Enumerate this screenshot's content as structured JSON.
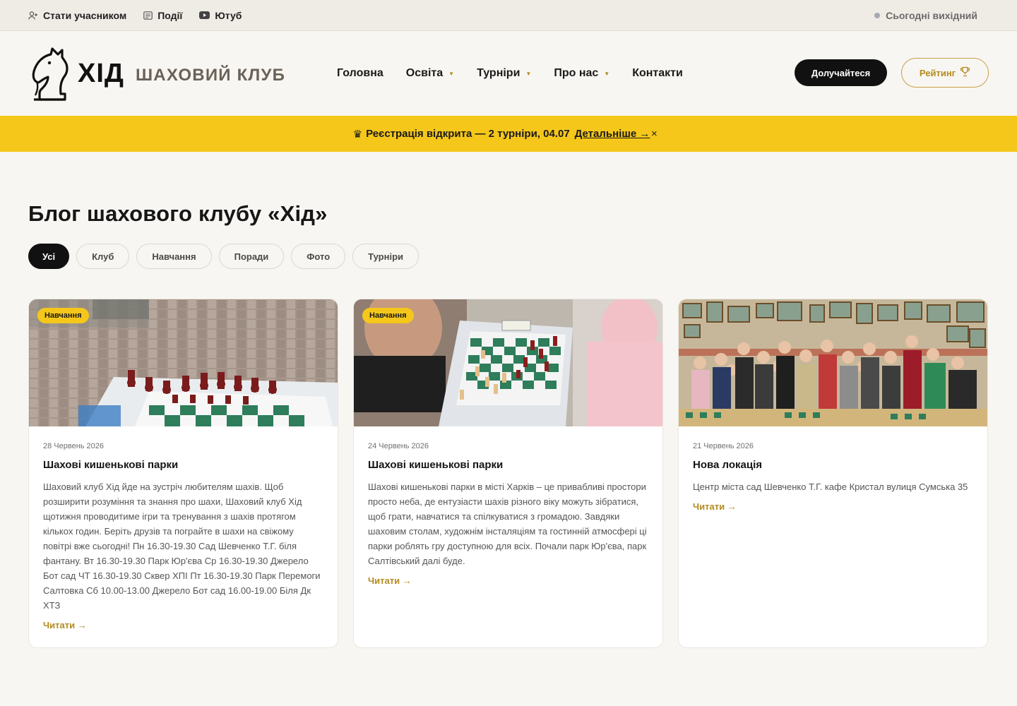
{
  "topbar": {
    "links": [
      {
        "label": "Стати учасником",
        "icon": "user-plus-icon"
      },
      {
        "label": "Події",
        "icon": "newspaper-icon"
      },
      {
        "label": "Ютуб",
        "icon": "youtube-icon"
      }
    ],
    "status": "Сьогодні вихідний"
  },
  "logo": {
    "title": "ХІД",
    "subtitle": "ШАХОВИЙ КЛУБ",
    "icon": "chess-knight-icon"
  },
  "nav": {
    "items": [
      {
        "label": "Головна",
        "has_dropdown": false
      },
      {
        "label": "Освіта",
        "has_dropdown": true
      },
      {
        "label": "Турніри",
        "has_dropdown": true
      },
      {
        "label": "Про нас",
        "has_dropdown": true
      },
      {
        "label": "Контакти",
        "has_dropdown": false
      }
    ]
  },
  "actions": {
    "join": "Долучайтеся",
    "rating": "Рейтинг",
    "rating_icon": "trophy-icon"
  },
  "announcement": {
    "crown": "♛",
    "text": "Реєстрація відкрита — 2 турніри, 04.07",
    "link": "Детальніше →",
    "close": "×"
  },
  "page": {
    "title": "Блог шахового клубу «Хід»"
  },
  "filters": [
    "Усі",
    "Клуб",
    "Навчання",
    "Поради",
    "Фото",
    "Турніри"
  ],
  "posts": [
    {
      "tag": "Навчання",
      "date": "28 Червень 2026",
      "title": "Шахові кишенькові парки",
      "text": "Шаховий клуб Хід йде на зустріч любителям шахів. Щоб розширити розуміння та знання про шахи, Шаховий клуб Хід щотижня проводитиме ігри та тренування з шахів протягом кількох годин. Беріть друзів та пограйте в шахи на свіжому повітрі вже сьогодні! Пн 16.30-19.30 Сад Шевченко Т.Г. біля фантану. Вт 16.30-19.30 Парк Юр'єва Ср 16.30-19.30 Джерело Бот сад ЧТ 16.30-19.30 Сквер ХПІ Пт 16.30-19.30 Парк Перемоги Салтовка Сб 10.00-13.00 Джерело Бот сад 16.00-19.00 Біля Дк ХТЗ",
      "read": "Читати →"
    },
    {
      "tag": "Навчання",
      "date": "24 Червень 2026",
      "title": "Шахові кишенькові парки",
      "text": "Шахові кишенькові парки в місті Харків – це привабливі простори просто неба, де ентузіасти шахів різного віку можуть зібратися, щоб грати, навчатися та спілкуватися з громадою. Завдяки шаховим столам, художнім інсталяціям та гостинній атмосфері ці парки роблять гру доступною для всіх. Почали парк Юр'єва, парк Салтівський далі буде.",
      "read": "Читати →"
    },
    {
      "tag": "",
      "date": "21 Червень 2026",
      "title": "Нова локація",
      "text": "Центр міста сад Шевченко Т.Г. кафе Кристал вулиця Сумська 35",
      "read": "Читати →"
    }
  ],
  "colors": {
    "accent": "#f5c71a",
    "gold": "#b38a1e",
    "dark": "#111111",
    "bg": "#f8f6f2"
  }
}
